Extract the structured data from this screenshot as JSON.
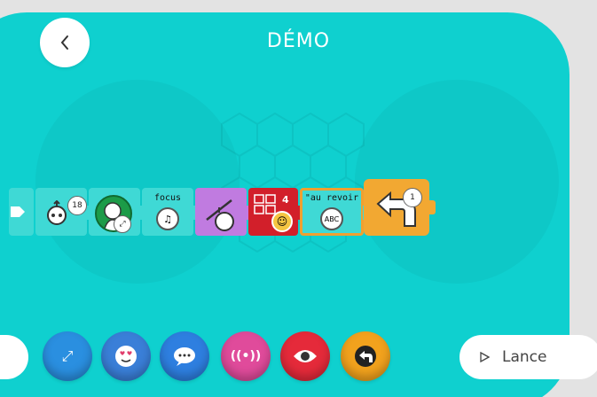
{
  "header": {
    "title": "DÉMO"
  },
  "program_blocks": [
    {
      "id": "partial",
      "label": ""
    },
    {
      "id": "robot",
      "badge": "18"
    },
    {
      "id": "character",
      "label": ""
    },
    {
      "id": "focus",
      "label": "focus"
    },
    {
      "id": "paint",
      "label": ""
    },
    {
      "id": "grid",
      "label": "4"
    },
    {
      "id": "say",
      "label": "\"au revoir"
    },
    {
      "id": "repeat",
      "badge": "1"
    }
  ],
  "palette": [
    {
      "id": "zoom",
      "color": "#2a8fe0",
      "icon": "expand-icon"
    },
    {
      "id": "face",
      "color": "#3a7fd8",
      "icon": "love-face-icon"
    },
    {
      "id": "chat",
      "color": "#2e7fe0",
      "icon": "speech-bubble-icon"
    },
    {
      "id": "signal",
      "color": "#e04b9b",
      "icon": "broadcast-icon"
    },
    {
      "id": "eye",
      "color": "#e52a3a",
      "icon": "eye-icon"
    },
    {
      "id": "turn",
      "color": "#f2a21d",
      "icon": "turn-back-icon"
    }
  ],
  "launch_button": {
    "label": "Lance"
  }
}
